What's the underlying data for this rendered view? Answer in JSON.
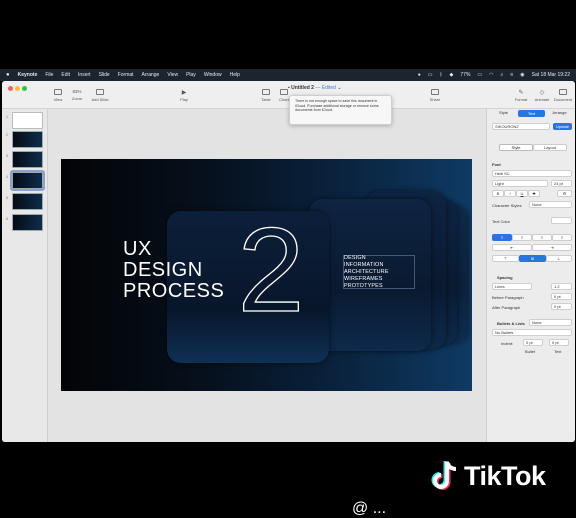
{
  "menubar": {
    "apple": "",
    "items": [
      "Keynote",
      "File",
      "Edit",
      "Insert",
      "Slide",
      "Format",
      "Arrange",
      "View",
      "Play",
      "Window",
      "Help"
    ],
    "battery": "77%",
    "clock": "Sat 18 Mar  19:22"
  },
  "toolbar": {
    "view": "View",
    "zoom_value": "83%",
    "zoom": "Zoom",
    "add_slide": "Add Slide",
    "play": "Play",
    "table": "Table",
    "chart": "Chart",
    "share": "Share",
    "format": "Format",
    "animate": "Animate",
    "document": "Document"
  },
  "document": {
    "title": "Untitled 2",
    "status": "— Edited",
    "tooltip": "There is not enough space to save this document in iCloud. Purchase additional storage or remove some documents from iCloud."
  },
  "navigator": {
    "slide_numbers": [
      "1",
      "2",
      "3",
      "4",
      "5",
      "6"
    ]
  },
  "slide": {
    "title_lines": [
      "UX",
      "DESIGN",
      "PROCESS"
    ],
    "number": "2",
    "topics": [
      "DESIGN",
      "INFORMATION",
      "ARCHITECTURE",
      "WIREFRAMES",
      "PROTOTYPES"
    ]
  },
  "inspector": {
    "tabs": [
      "Style",
      "Text",
      "Arrange"
    ],
    "paragraph_style": "SIKOURON2",
    "update": "Update",
    "sub_tabs": [
      "Style",
      "Layout"
    ],
    "font_section": "Font",
    "font_name": "Heiti SC",
    "font_weight": "Light",
    "font_size": "24 pt",
    "character_styles": "Character Styles",
    "character_styles_value": "None",
    "text_color": "Text Color",
    "spacing": "Spacing",
    "spacing_mode": "Lines",
    "spacing_value": "1.2",
    "before_paragraph": "Before Paragraph",
    "before_value": "0 pt",
    "after_paragraph": "After Paragraph",
    "after_value": "0 pt",
    "bullets_lists": "Bullets & Lists",
    "bullets_value": "None",
    "no_bullets": "No Bullets",
    "indent": "Indent:",
    "indent_bullet": "0 pt",
    "indent_text": "0 pt",
    "bullet_col": "Bullet",
    "text_col": "Text"
  },
  "overlay": {
    "tiktok": "TikTok",
    "watermark": "@ ..."
  }
}
